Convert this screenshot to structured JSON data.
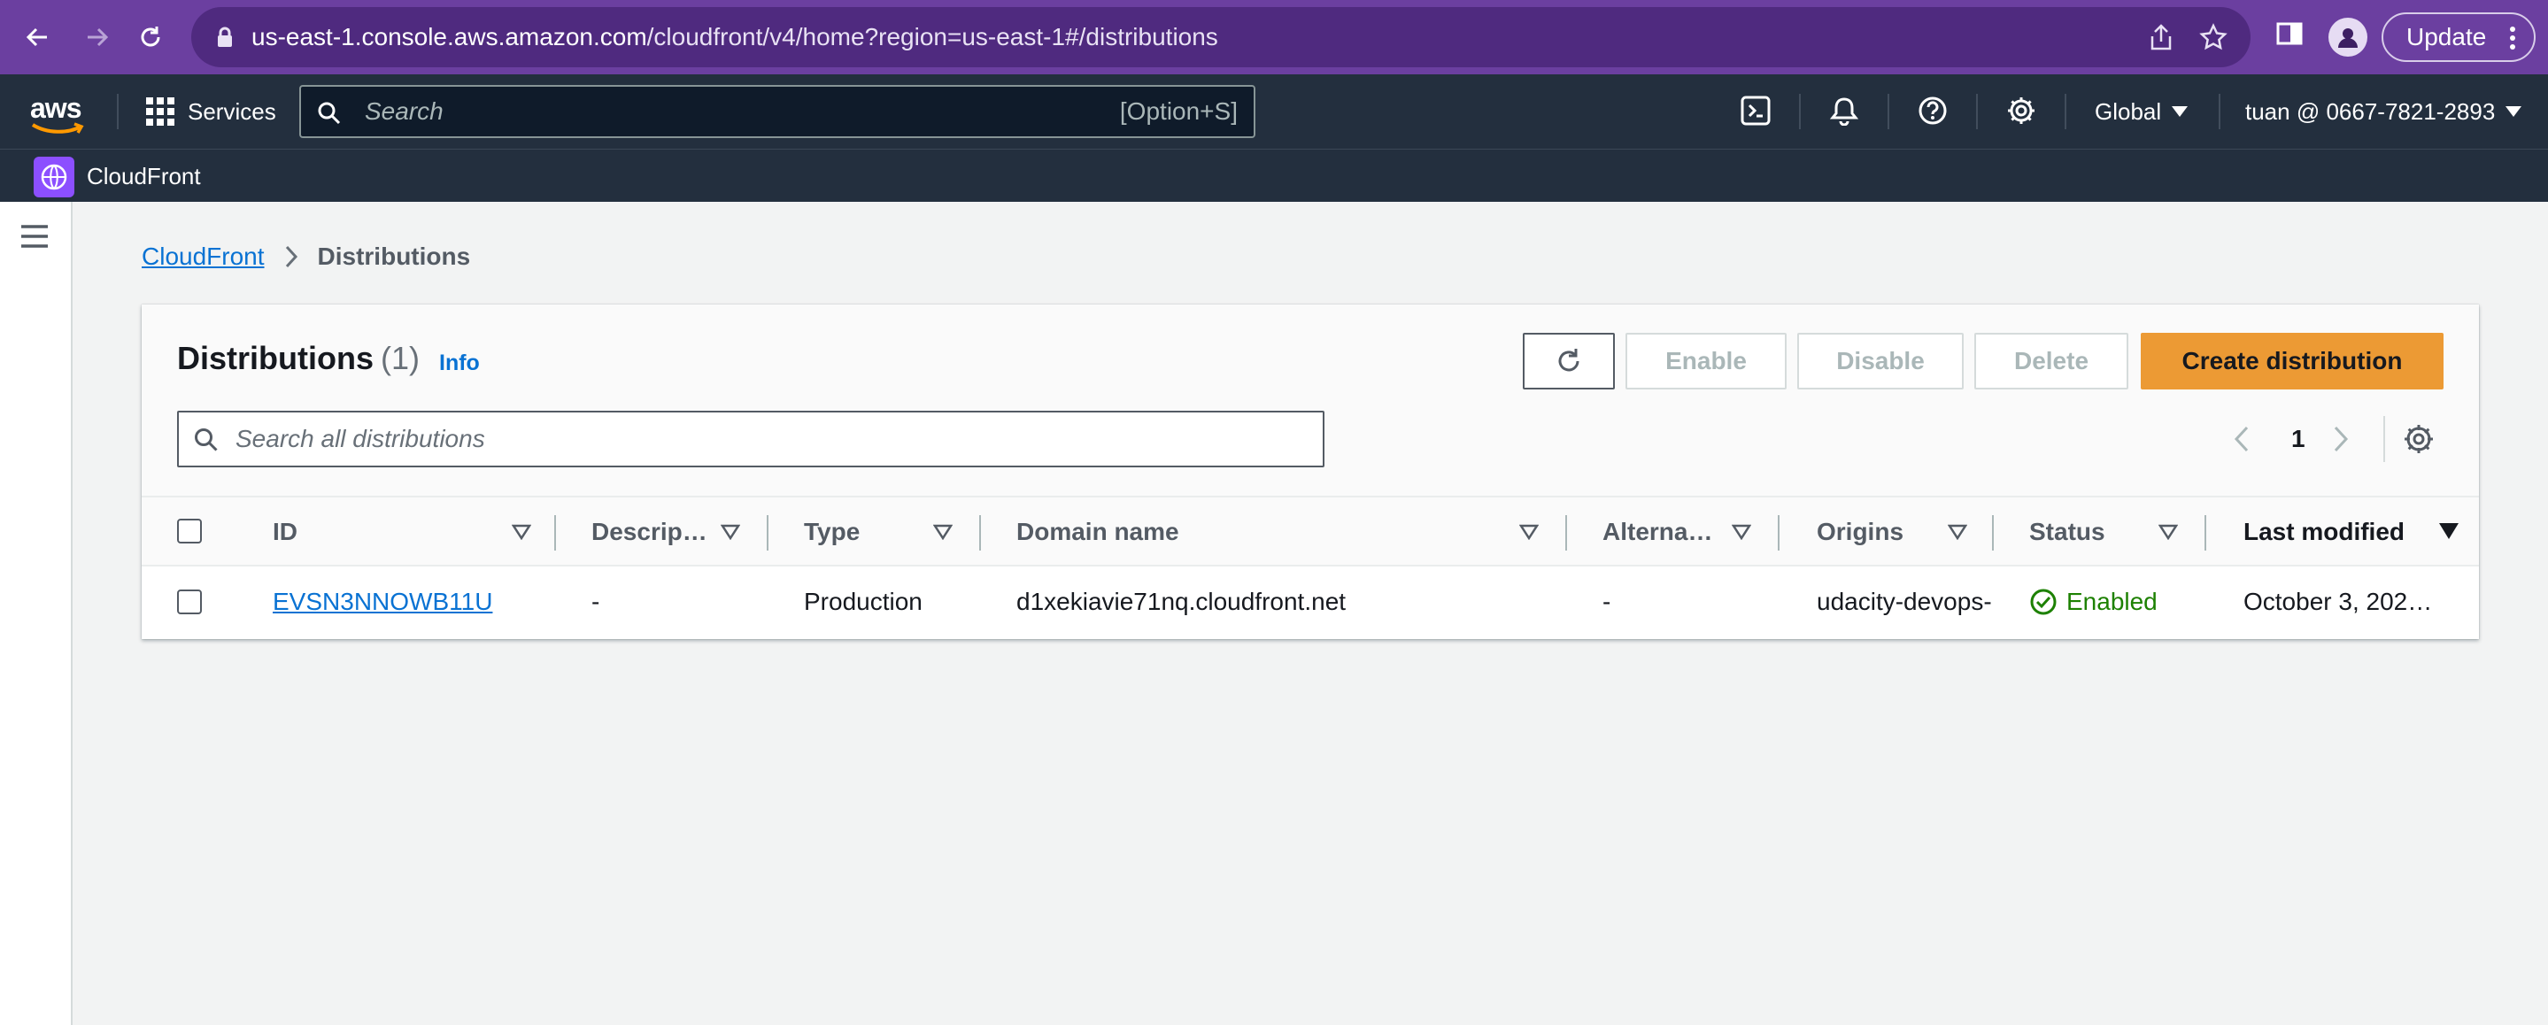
{
  "browser": {
    "url_host": "us-east-1.console.aws.amazon.com",
    "url_path": "/cloudfront/v4/home?region=us-east-1#/distributions",
    "update_label": "Update"
  },
  "header": {
    "logo_text": "aws",
    "services_label": "Services",
    "search_placeholder": "Search",
    "search_shortcut": "[Option+S]",
    "region": "Global",
    "account": "tuan @ 0667-7821-2893"
  },
  "service_bar": {
    "name": "CloudFront"
  },
  "breadcrumb": {
    "root": "CloudFront",
    "current": "Distributions"
  },
  "panel": {
    "title": "Distributions",
    "count": "(1)",
    "info_label": "Info",
    "buttons": {
      "enable": "Enable",
      "disable": "Disable",
      "delete": "Delete",
      "create": "Create distribution"
    },
    "filter_placeholder": "Search all distributions",
    "page_number": "1"
  },
  "table": {
    "columns": [
      "ID",
      "Descrip…",
      "Type",
      "Domain name",
      "Alterna…",
      "Origins",
      "Status",
      "Last modified"
    ],
    "rows": [
      {
        "id": "EVSN3NNOWB11U",
        "description": "-",
        "type": "Production",
        "domain": "d1xekiavie71nq.cloudfront.net",
        "alternate": "-",
        "origins": "udacity-devops-",
        "status": "Enabled",
        "last_modified": "October 3, 202…"
      }
    ]
  },
  "colors": {
    "browser_chrome": "#6b3fa0",
    "aws_nav": "#232f3e",
    "primary_button": "#ec9a34",
    "link": "#0972d3",
    "status_enabled": "#1d8102"
  }
}
